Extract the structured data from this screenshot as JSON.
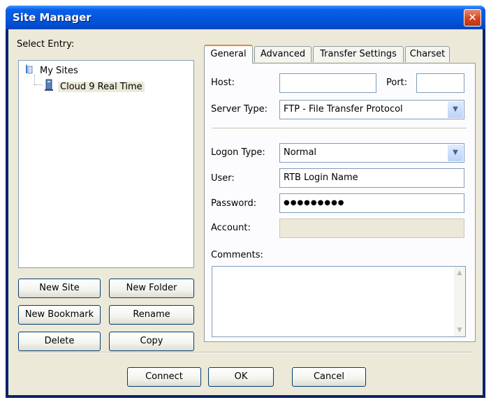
{
  "window": {
    "title": "Site Manager",
    "close_icon": "close-icon"
  },
  "left": {
    "select_label": "Select Entry:",
    "tree": [
      {
        "label": "My Sites",
        "icon": "folder-icon"
      },
      {
        "label": "Cloud 9 Real Time",
        "icon": "server-icon",
        "selected": true
      }
    ],
    "buttons": {
      "new_site": "New Site",
      "new_folder": "New Folder",
      "new_bookmark": "New Bookmark",
      "rename": "Rename",
      "delete": "Delete",
      "copy": "Copy"
    }
  },
  "tabs": [
    {
      "label": "General",
      "active": true
    },
    {
      "label": "Advanced",
      "active": false
    },
    {
      "label": "Transfer Settings",
      "active": false
    },
    {
      "label": "Charset",
      "active": false
    }
  ],
  "general": {
    "host_label": "Host:",
    "host_value": "",
    "port_label": "Port:",
    "port_value": "",
    "server_type_label": "Server Type:",
    "server_type_value": "FTP - File Transfer Protocol",
    "logon_type_label": "Logon Type:",
    "logon_type_value": "Normal",
    "user_label": "User:",
    "user_value": "RTB Login Name",
    "password_label": "Password:",
    "password_value": "●●●●●●●●●",
    "account_label": "Account:",
    "account_value": "",
    "comments_label": "Comments:",
    "comments_value": ""
  },
  "footer": {
    "connect": "Connect",
    "ok": "OK",
    "cancel": "Cancel"
  },
  "colors": {
    "title_bar": "#0254dc",
    "client_bg": "#ece9d8",
    "active_tab_accent": "#e68b2c",
    "close_button": "#d2451e"
  }
}
